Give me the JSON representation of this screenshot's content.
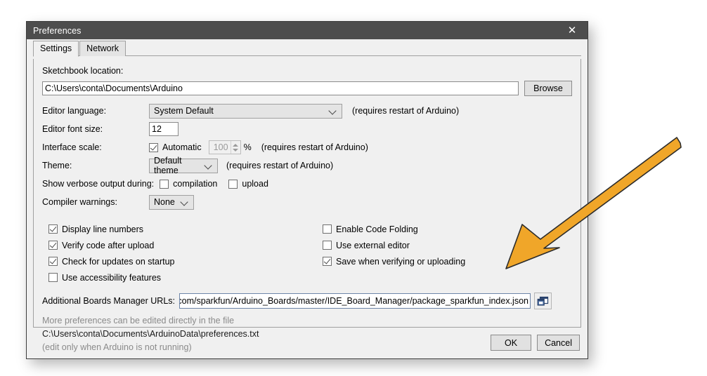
{
  "window": {
    "title": "Preferences",
    "close_icon": "close-icon"
  },
  "tabs": [
    {
      "label": "Settings",
      "active": true
    },
    {
      "label": "Network",
      "active": false
    }
  ],
  "settings": {
    "sketchbook": {
      "label": "Sketchbook location:",
      "value": "C:\\Users\\conta\\Documents\\Arduino",
      "browse_label": "Browse"
    },
    "editor_language": {
      "label": "Editor language:",
      "value": "System Default",
      "note": "(requires restart of Arduino)"
    },
    "editor_font_size": {
      "label": "Editor font size:",
      "value": "12"
    },
    "interface_scale": {
      "label": "Interface scale:",
      "automatic_label": "Automatic",
      "automatic_checked": true,
      "scale_value": "100",
      "percent_label": "%",
      "note": "(requires restart of Arduino)"
    },
    "theme": {
      "label": "Theme:",
      "value": "Default theme",
      "note": "(requires restart of Arduino)"
    },
    "verbose_output": {
      "label": "Show verbose output during:",
      "compilation_label": "compilation",
      "compilation_checked": false,
      "upload_label": "upload",
      "upload_checked": false
    },
    "compiler_warnings": {
      "label": "Compiler warnings:",
      "value": "None"
    },
    "checkboxes_left": [
      {
        "label": "Display line numbers",
        "checked": true
      },
      {
        "label": "Verify code after upload",
        "checked": true
      },
      {
        "label": "Check for updates on startup",
        "checked": true
      },
      {
        "label": "Use accessibility features",
        "checked": false
      }
    ],
    "checkboxes_right": [
      {
        "label": "Enable Code Folding",
        "checked": false
      },
      {
        "label": "Use external editor",
        "checked": false
      },
      {
        "label": "Save when verifying or uploading",
        "checked": true
      }
    ],
    "boards_urls": {
      "label": "Additional Boards Manager URLs:",
      "value": "usercontent.com/sparkfun/Arduino_Boards/master/IDE_Board_Manager/package_sparkfun_index.json",
      "open_editor_icon": "open-window-icon"
    },
    "footer": {
      "line1": "More preferences can be edited directly in the file",
      "line2": "C:\\Users\\conta\\Documents\\ArduinoData\\preferences.txt",
      "line3": "(edit only when Arduino is not running)"
    }
  },
  "buttons": {
    "ok_label": "OK",
    "cancel_label": "Cancel"
  },
  "annotation": {
    "arrow_color": "#F0A629",
    "arrow_outline": "#2b2b2b"
  }
}
